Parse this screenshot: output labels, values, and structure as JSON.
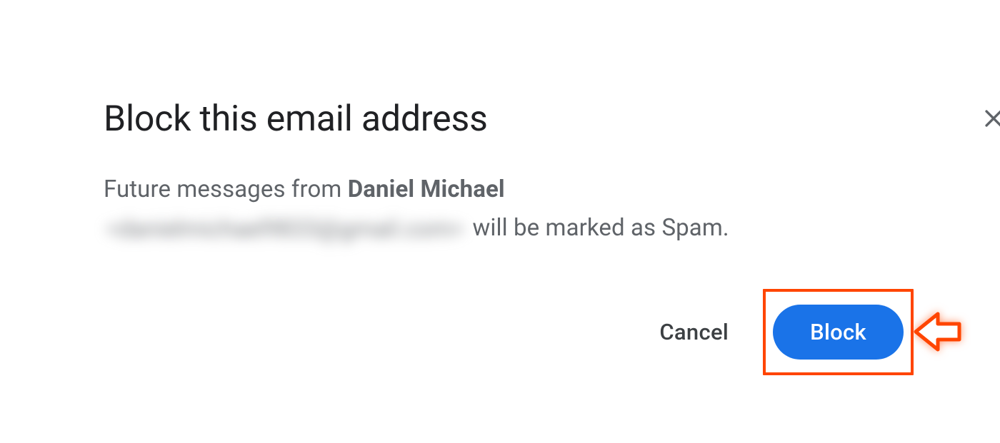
{
  "dialog": {
    "title": "Block this email address",
    "close_icon": "close-icon",
    "body": {
      "prefix": "Future messages from ",
      "sender_name": "Daniel Michael",
      "redacted_email": "<danielmichael9833@gmail.com>",
      "suffix": " will be marked as Spam."
    },
    "actions": {
      "cancel_label": "Cancel",
      "block_label": "Block"
    }
  },
  "annotation": {
    "highlight_color": "#ff4500",
    "primary_button_color": "#1a73e8"
  }
}
